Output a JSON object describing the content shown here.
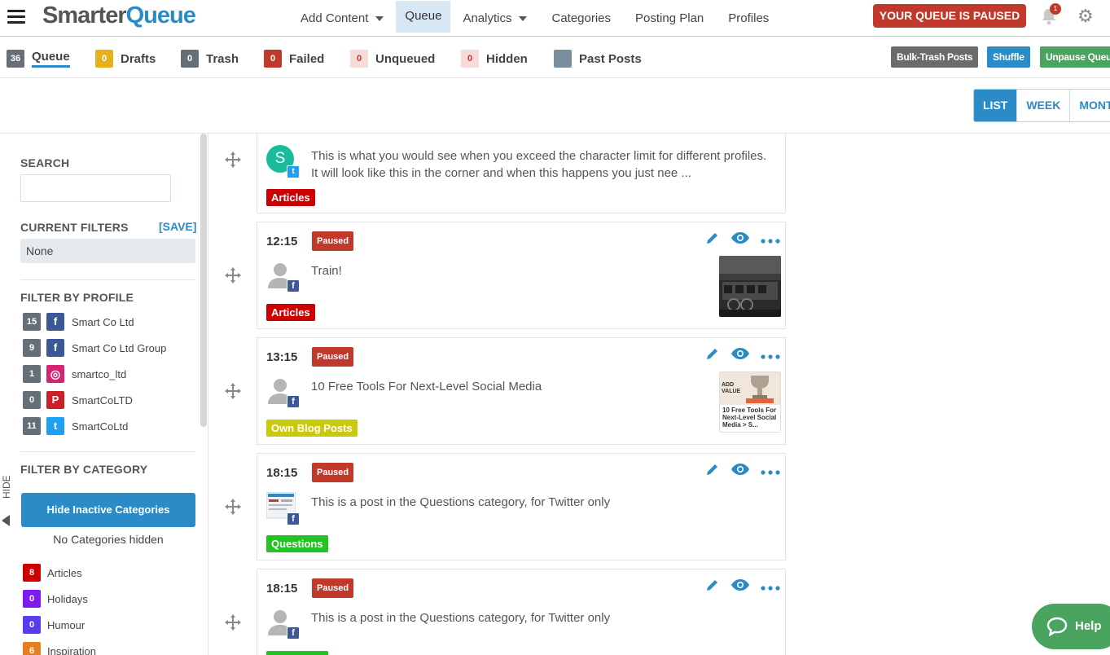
{
  "header": {
    "logo_part1": "Smarter",
    "logo_part2": "Queue",
    "nav": [
      {
        "label": "Add Content",
        "dropdown": true
      },
      {
        "label": "Queue",
        "active": true
      },
      {
        "label": "Analytics",
        "dropdown": true
      },
      {
        "label": "Categories"
      },
      {
        "label": "Posting Plan"
      },
      {
        "label": "Profiles"
      }
    ],
    "paused_label": "YOUR QUEUE IS PAUSED",
    "notification_count": "1"
  },
  "tabs": [
    {
      "count": "36",
      "label": "Queue",
      "color": "#666f78"
    },
    {
      "count": "0",
      "label": "Drafts",
      "color": "#e5b21c"
    },
    {
      "count": "0",
      "label": "Trash",
      "color": "#666f78"
    },
    {
      "count": "0",
      "label": "Failed",
      "color": "#c0392b"
    },
    {
      "count": "0",
      "label": "Unqueued",
      "color": "#f6dcd9"
    },
    {
      "count": "0",
      "label": "Hidden",
      "color": "#f6dcd9"
    },
    {
      "count": "",
      "label": "Past Posts",
      "color": "#7a8f9e"
    }
  ],
  "toolbar": {
    "bulk_trash": "Bulk-Trash Posts",
    "shuffle": "Shuffle",
    "unpause": "Unpause Queu"
  },
  "views": {
    "list": "LIST",
    "week": "WEEK",
    "month": "MONTH"
  },
  "sidebar": {
    "hide_label": "HIDE",
    "search_heading": "SEARCH",
    "search_value": "",
    "current_filters_heading": "CURRENT FILTERS",
    "save_label": "[SAVE]",
    "current_filters_value": "None",
    "profile_heading": "FILTER BY PROFILE",
    "profiles": [
      {
        "count": "15",
        "network": "facebook",
        "glyph": "f",
        "color": "#3b5998",
        "name": "Smart Co Ltd"
      },
      {
        "count": "9",
        "network": "facebook-group",
        "glyph": "f",
        "color": "#3b5998",
        "name": "Smart Co Ltd Group"
      },
      {
        "count": "1",
        "network": "instagram",
        "glyph": "◎",
        "color": "#d6246e",
        "name": "smartco_ltd"
      },
      {
        "count": "0",
        "network": "pinterest",
        "glyph": "P",
        "color": "#cb2027",
        "name": "SmartCoLTD"
      },
      {
        "count": "11",
        "network": "twitter",
        "glyph": "t",
        "color": "#1da1f2",
        "name": "SmartCoLtd"
      }
    ],
    "category_heading": "FILTER BY CATEGORY",
    "hide_inactive_label": "Hide Inactive Categories",
    "no_hidden_label": "No Categories hidden",
    "categories": [
      {
        "count": "8",
        "name": "Articles",
        "color": "#cc0000"
      },
      {
        "count": "0",
        "name": "Holidays",
        "color": "#7d1aef"
      },
      {
        "count": "0",
        "name": "Humour",
        "color": "#5a3cf0"
      },
      {
        "count": "6",
        "name": "Inspiration",
        "color": "#e67e22"
      }
    ]
  },
  "posts": [
    {
      "time": "",
      "status": "",
      "text": "This is what you would see when you exceed the character limit for different profiles. It will look like this in the corner and when this happens you just nee ...",
      "category": "Articles",
      "category_color": "#cc0000",
      "network": "twitter",
      "avatar": "letter",
      "avatar_letter": "S",
      "thumb": ""
    },
    {
      "time": "12:15",
      "status": "Paused",
      "text": "Train!",
      "category": "Articles",
      "category_color": "#cc0000",
      "network": "facebook",
      "avatar": "person",
      "thumb": "train"
    },
    {
      "time": "13:15",
      "status": "Paused",
      "text": "10 Free Tools For Next-Level Social Media",
      "category": "Own Blog Posts",
      "category_color": "#c9c90e",
      "network": "facebook",
      "avatar": "person",
      "thumb": "article",
      "thumb_top": "ADD VALUE",
      "thumb_caption": "10 Free Tools For Next-Level Social Media > S..."
    },
    {
      "time": "18:15",
      "status": "Paused",
      "text": "This is a post in the Questions category, for Twitter only",
      "category": "Questions",
      "category_color": "#22c322",
      "network": "facebook-group",
      "avatar": "screenshot",
      "thumb": ""
    },
    {
      "time": "18:15",
      "status": "Paused",
      "text": "This is a post in the Questions category, for Twitter only",
      "category": "",
      "category_color": "#22c322",
      "network": "facebook",
      "avatar": "person",
      "thumb": ""
    }
  ],
  "help_label": "Help"
}
